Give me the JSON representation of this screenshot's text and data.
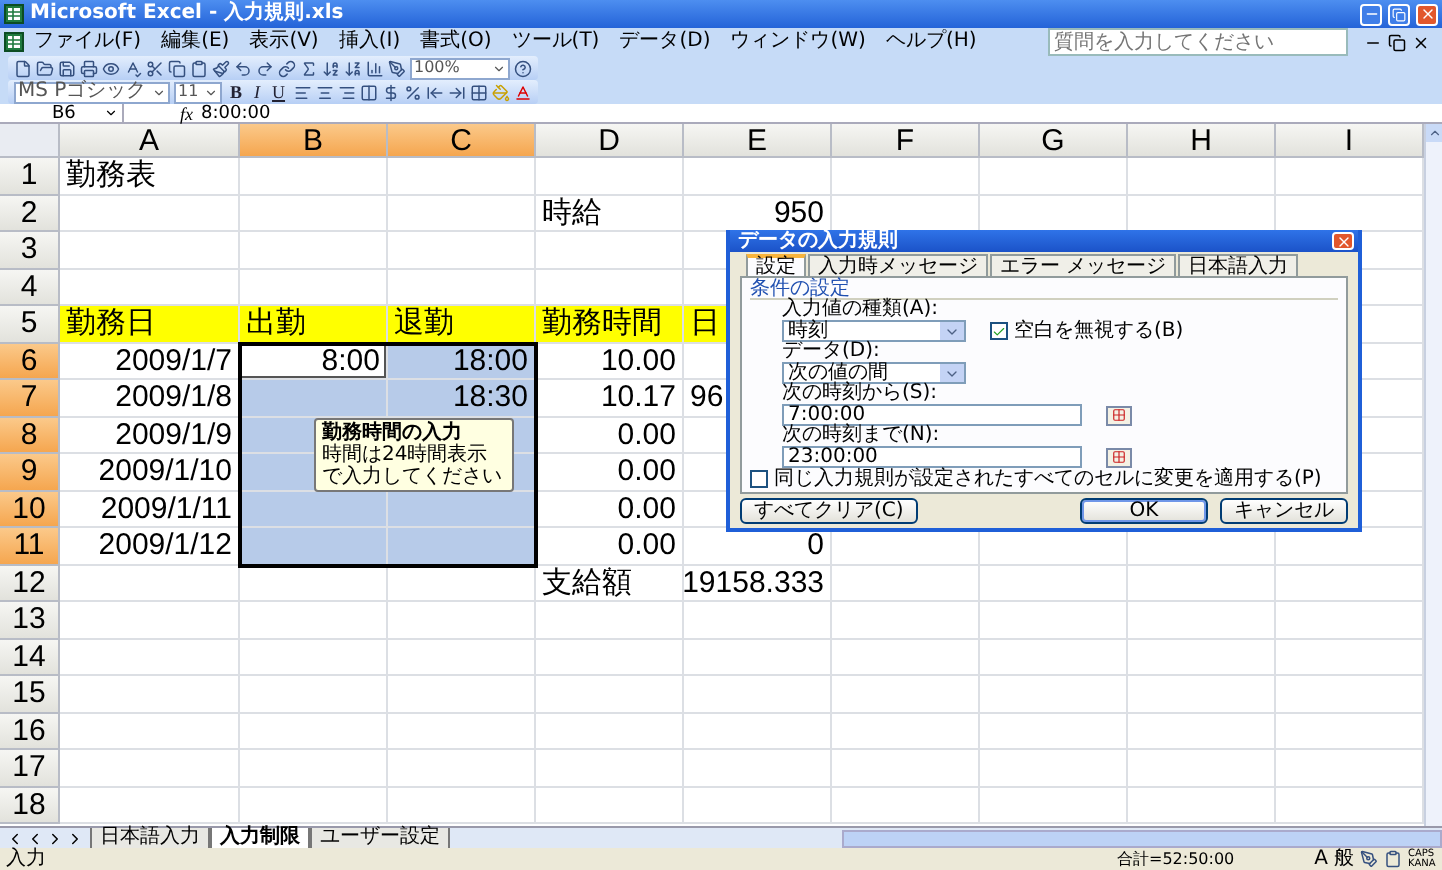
{
  "window": {
    "title": "Microsoft Excel - 入力規則.xls"
  },
  "menu": [
    "ファイル(F)",
    "編集(E)",
    "表示(V)",
    "挿入(I)",
    "書式(O)",
    "ツール(T)",
    "データ(D)",
    "ウィンドウ(W)",
    "ヘルプ(H)"
  ],
  "help_box": {
    "placeholder": "質問を入力してください"
  },
  "standard_toolbar": {
    "zoom": "100%"
  },
  "formatting_toolbar": {
    "font": "MS Pゴシック",
    "size": "11",
    "style_buttons": [
      "B",
      "I",
      "U"
    ]
  },
  "formula_bar": {
    "name_box": "B6",
    "function_label": "fx",
    "formula": "8:00:00"
  },
  "sheet": {
    "columns": [
      {
        "label": "A",
        "selected": false
      },
      {
        "label": "B",
        "selected": true
      },
      {
        "label": "C",
        "selected": true
      },
      {
        "label": "D",
        "selected": false
      },
      {
        "label": "E",
        "selected": false
      },
      {
        "label": "F",
        "selected": false
      },
      {
        "label": "G",
        "selected": false
      },
      {
        "label": "H",
        "selected": false
      },
      {
        "label": "I",
        "selected": false
      }
    ],
    "rows": [
      {
        "label": "1",
        "selected": false,
        "cells": [
          {
            "text": "勤務表",
            "kind": "text",
            "selected": false,
            "active": false
          },
          {
            "selected": false,
            "active": false
          },
          {
            "selected": false,
            "active": false
          },
          {
            "selected": false,
            "active": false
          },
          {
            "selected": false,
            "active": false
          },
          {
            "selected": false,
            "active": false
          },
          {
            "selected": false,
            "active": false
          },
          {
            "selected": false,
            "active": false
          },
          {
            "selected": false,
            "active": false
          }
        ]
      },
      {
        "label": "2",
        "selected": false,
        "cells": [
          {
            "selected": false,
            "active": false
          },
          {
            "selected": false,
            "active": false
          },
          {
            "selected": false,
            "active": false
          },
          {
            "text": "時給",
            "kind": "text",
            "selected": false,
            "active": false
          },
          {
            "text": "950",
            "kind": "number",
            "selected": false,
            "active": false
          },
          {
            "selected": false,
            "active": false
          },
          {
            "selected": false,
            "active": false
          },
          {
            "selected": false,
            "active": false
          },
          {
            "selected": false,
            "active": false
          }
        ]
      },
      {
        "label": "3",
        "selected": false,
        "cells": [
          {
            "selected": false,
            "active": false
          },
          {
            "selected": false,
            "active": false
          },
          {
            "selected": false,
            "active": false
          },
          {
            "selected": false,
            "active": false
          },
          {
            "selected": false,
            "active": false
          },
          null,
          null,
          null,
          {
            "selected": false,
            "active": false
          }
        ]
      },
      {
        "label": "4",
        "selected": false,
        "cells": [
          {
            "selected": false,
            "active": false
          },
          {
            "selected": false,
            "active": false
          },
          {
            "selected": false,
            "active": false
          },
          {
            "selected": false,
            "active": false
          },
          {
            "selected": false,
            "active": false
          },
          null,
          null,
          null,
          {
            "selected": false,
            "active": false
          }
        ]
      },
      {
        "label": "5",
        "selected": false,
        "cells": [
          {
            "text": "勤務日",
            "kind": "text",
            "color": "#ffff00",
            "selected": false,
            "active": false
          },
          {
            "text": "出勤",
            "kind": "text",
            "color": "#ffff00",
            "selected": false,
            "active": false
          },
          {
            "text": "退勤",
            "kind": "text",
            "color": "#ffff00",
            "selected": false,
            "active": false
          },
          {
            "text": "勤務時間",
            "kind": "text",
            "color": "#ffff00",
            "selected": false,
            "active": false
          },
          {
            "text": "日",
            "kind": "text",
            "color": "#ffff00",
            "selected": false,
            "active": false
          },
          null,
          null,
          null,
          {
            "selected": false,
            "active": false
          }
        ]
      },
      {
        "label": "6",
        "selected": true,
        "cells": [
          {
            "text": "2009/1/7",
            "kind": "number",
            "selected": false,
            "active": false
          },
          {
            "text": "8:00",
            "kind": "number",
            "selected": true,
            "active": true
          },
          {
            "text": "18:00",
            "kind": "number",
            "selected": true,
            "active": false
          },
          {
            "text": "10.00",
            "kind": "number",
            "selected": false,
            "active": false
          },
          {
            "selected": false,
            "active": false
          },
          null,
          null,
          null,
          {
            "selected": false,
            "active": false
          }
        ]
      },
      {
        "label": "7",
        "selected": true,
        "cells": [
          {
            "text": "2009/1/8",
            "kind": "number",
            "selected": false,
            "active": false
          },
          {
            "selected": true,
            "active": false
          },
          {
            "text": "18:30",
            "kind": "number",
            "selected": true,
            "active": false
          },
          {
            "text": "10.17",
            "kind": "number",
            "selected": false,
            "active": false
          },
          {
            "text": "96",
            "kind": "text",
            "selected": false,
            "active": false
          },
          null,
          null,
          null,
          {
            "selected": false,
            "active": false
          }
        ]
      },
      {
        "label": "8",
        "selected": true,
        "cells": [
          {
            "text": "2009/1/9",
            "kind": "number",
            "selected": false,
            "active": false
          },
          {
            "selected": true,
            "active": false
          },
          {
            "selected": true,
            "active": false
          },
          {
            "text": "0.00",
            "kind": "number",
            "selected": false,
            "active": false
          },
          {
            "selected": false,
            "active": false
          },
          null,
          null,
          null,
          {
            "selected": false,
            "active": false
          }
        ]
      },
      {
        "label": "9",
        "selected": true,
        "cells": [
          {
            "text": "2009/1/10",
            "kind": "number",
            "selected": false,
            "active": false
          },
          {
            "selected": true,
            "active": false
          },
          {
            "selected": true,
            "active": false
          },
          {
            "text": "0.00",
            "kind": "number",
            "selected": false,
            "active": false
          },
          {
            "selected": false,
            "active": false
          },
          null,
          null,
          null,
          {
            "selected": false,
            "active": false
          }
        ]
      },
      {
        "label": "10",
        "selected": true,
        "cells": [
          {
            "text": "2009/1/11",
            "kind": "number",
            "selected": false,
            "active": false
          },
          {
            "selected": true,
            "active": false
          },
          {
            "selected": true,
            "active": false
          },
          {
            "text": "0.00",
            "kind": "number",
            "selected": false,
            "active": false
          },
          {
            "selected": false,
            "active": false
          },
          null,
          null,
          null,
          {
            "selected": false,
            "active": false
          }
        ]
      },
      {
        "label": "11",
        "selected": true,
        "cells": [
          {
            "text": "2009/1/12",
            "kind": "number",
            "selected": false,
            "active": false
          },
          {
            "selected": true,
            "active": false
          },
          {
            "selected": true,
            "active": false
          },
          {
            "text": "0.00",
            "kind": "number",
            "selected": false,
            "active": false
          },
          {
            "text": "0",
            "kind": "number",
            "selected": false,
            "active": false
          },
          {
            "selected": false,
            "active": false
          },
          {
            "selected": false,
            "active": false
          },
          {
            "selected": false,
            "active": false
          },
          {
            "selected": false,
            "active": false
          }
        ]
      },
      {
        "label": "12",
        "selected": false,
        "cells": [
          {
            "selected": false,
            "active": false
          },
          {
            "selected": false,
            "active": false
          },
          {
            "selected": false,
            "active": false
          },
          {
            "text": "支給額",
            "kind": "text",
            "selected": false,
            "active": false
          },
          {
            "text": "19158.333",
            "kind": "number",
            "selected": false,
            "active": false
          },
          {
            "selected": false,
            "active": false
          },
          {
            "selected": false,
            "active": false
          },
          {
            "selected": false,
            "active": false
          },
          {
            "selected": false,
            "active": false
          }
        ]
      },
      {
        "label": "13",
        "selected": false,
        "cells": [
          {
            "selected": false,
            "active": false
          },
          {
            "selected": false,
            "active": false
          },
          {
            "selected": false,
            "active": false
          },
          {
            "selected": false,
            "active": false
          },
          {
            "selected": false,
            "active": false
          },
          {
            "selected": false,
            "active": false
          },
          {
            "selected": false,
            "active": false
          },
          {
            "selected": false,
            "active": false
          },
          {
            "selected": false,
            "active": false
          }
        ]
      },
      {
        "label": "14",
        "selected": false,
        "cells": [
          {
            "selected": false,
            "active": false
          },
          {
            "selected": false,
            "active": false
          },
          {
            "selected": false,
            "active": false
          },
          {
            "selected": false,
            "active": false
          },
          {
            "selected": false,
            "active": false
          },
          {
            "selected": false,
            "active": false
          },
          {
            "selected": false,
            "active": false
          },
          {
            "selected": false,
            "active": false
          },
          {
            "selected": false,
            "active": false
          }
        ]
      },
      {
        "label": "15",
        "selected": false,
        "cells": [
          {
            "selected": false,
            "active": false
          },
          {
            "selected": false,
            "active": false
          },
          {
            "selected": false,
            "active": false
          },
          {
            "selected": false,
            "active": false
          },
          {
            "selected": false,
            "active": false
          },
          {
            "selected": false,
            "active": false
          },
          {
            "selected": false,
            "active": false
          },
          {
            "selected": false,
            "active": false
          },
          {
            "selected": false,
            "active": false
          }
        ]
      },
      {
        "label": "16",
        "selected": false,
        "cells": [
          {
            "selected": false,
            "active": false
          },
          {
            "selected": false,
            "active": false
          },
          {
            "selected": false,
            "active": false
          },
          {
            "selected": false,
            "active": false
          },
          {
            "selected": false,
            "active": false
          },
          {
            "selected": false,
            "active": false
          },
          {
            "selected": false,
            "active": false
          },
          {
            "selected": false,
            "active": false
          },
          {
            "selected": false,
            "active": false
          }
        ]
      },
      {
        "label": "17",
        "selected": false,
        "cells": [
          {
            "selected": false,
            "active": false
          },
          {
            "selected": false,
            "active": false
          },
          {
            "selected": false,
            "active": false
          },
          {
            "selected": false,
            "active": false
          },
          {
            "selected": false,
            "active": false
          },
          {
            "selected": false,
            "active": false
          },
          {
            "selected": false,
            "active": false
          },
          {
            "selected": false,
            "active": false
          },
          {
            "selected": false,
            "active": false
          }
        ]
      },
      {
        "label": "18",
        "selected": false,
        "cells": [
          {
            "selected": false,
            "active": false
          },
          {
            "selected": false,
            "active": false
          },
          {
            "selected": false,
            "active": false
          },
          {
            "selected": false,
            "active": false
          },
          {
            "selected": false,
            "active": false
          },
          {
            "selected": false,
            "active": false
          },
          {
            "selected": false,
            "active": false
          },
          {
            "selected": false,
            "active": false
          },
          {
            "selected": false,
            "active": false
          }
        ]
      }
    ]
  },
  "input_message": {
    "title": "勤務時間の入力",
    "text": "時間は24時間表示で入力してください"
  },
  "dialog": {
    "title": "データの入力規則",
    "tabs": [
      {
        "label": "設定",
        "selected": true
      },
      {
        "label": "入力時メッセージ",
        "selected": false
      },
      {
        "label": "エラー メッセージ",
        "selected": false
      },
      {
        "label": "日本語入力",
        "selected": false
      }
    ],
    "group": "条件の設定",
    "allow": {
      "label": "入力値の種類(A):",
      "value": "時刻"
    },
    "ignore_blank": {
      "label": "空白を無視する(B)",
      "checked": true
    },
    "data": {
      "label": "データ(D):",
      "value": "次の値の間"
    },
    "start": {
      "label": "次の時刻から(S):",
      "value": "7:00:00"
    },
    "end": {
      "label": "次の時刻まで(N):",
      "value": "23:00:00"
    },
    "apply_all": {
      "label": "同じ入力規則が設定されたすべてのセルに変更を適用する(P)",
      "checked": false
    },
    "buttons": [
      {
        "label": "すべてクリア(C)",
        "kind": "left"
      },
      {
        "label": "OK",
        "kind": "default"
      },
      {
        "label": "キャンセル",
        "kind": "normal"
      }
    ]
  },
  "sheet_tabs": [
    {
      "label": "日本語入力",
      "selected": false
    },
    {
      "label": "入力制限",
      "selected": true
    },
    {
      "label": "ユーザー設定",
      "selected": false
    }
  ],
  "status_bar": {
    "mode": "入力",
    "sum": "合計=52:50:00",
    "ime": [
      "A",
      "般"
    ],
    "indicator": "CAPS KANA"
  }
}
